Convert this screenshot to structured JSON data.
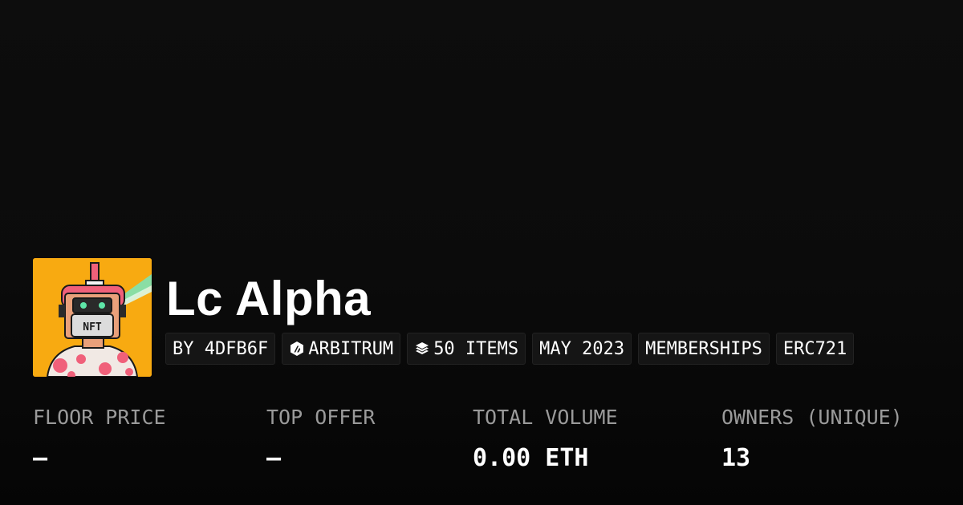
{
  "collection": {
    "title": "Lc Alpha",
    "avatar_icon": "nft-robot-avatar",
    "avatar_bg": "#f8aa11"
  },
  "tags": {
    "creator": "BY 4DFB6F",
    "chain": "ARBITRUM",
    "chain_icon": "arbitrum-icon",
    "items": "50 ITEMS",
    "items_icon": "layers-icon",
    "date": "MAY 2023",
    "category": "MEMBERSHIPS",
    "standard": "ERC721"
  },
  "stats": {
    "floor_label": "FLOOR PRICE",
    "floor_value": "—",
    "offer_label": "TOP OFFER",
    "offer_value": "—",
    "volume_label": "TOTAL VOLUME",
    "volume_value": "0.00 ETH",
    "owners_label": "OWNERS (UNIQUE)",
    "owners_value": "13"
  },
  "colors": {
    "background": "#0b0b0b",
    "tag_bg": "#151515",
    "label": "#9a9a9a",
    "text": "#ffffff"
  }
}
